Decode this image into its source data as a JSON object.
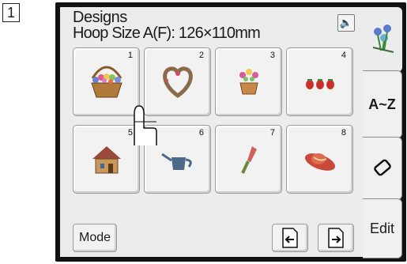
{
  "step": "1",
  "header": {
    "title": "Designs",
    "hoop": "Hoop Size A(F): 126×110mm"
  },
  "tiles": [
    {
      "number": "1",
      "icon": "flower-basket-icon"
    },
    {
      "number": "2",
      "icon": "heart-wreath-icon"
    },
    {
      "number": "3",
      "icon": "flower-pot-icon"
    },
    {
      "number": "4",
      "icon": "strawberries-icon"
    },
    {
      "number": "5",
      "icon": "house-icon"
    },
    {
      "number": "6",
      "icon": "watering-can-icon"
    },
    {
      "number": "7",
      "icon": "trowel-icon"
    },
    {
      "number": "8",
      "icon": "sun-hat-icon"
    }
  ],
  "footer": {
    "mode_label": "Mode"
  },
  "side_tabs": {
    "designs_icon": "flowers-tab-icon",
    "alphabet_label": "A~Z",
    "eraser_icon": "eraser-icon",
    "edit_label": "Edit"
  }
}
